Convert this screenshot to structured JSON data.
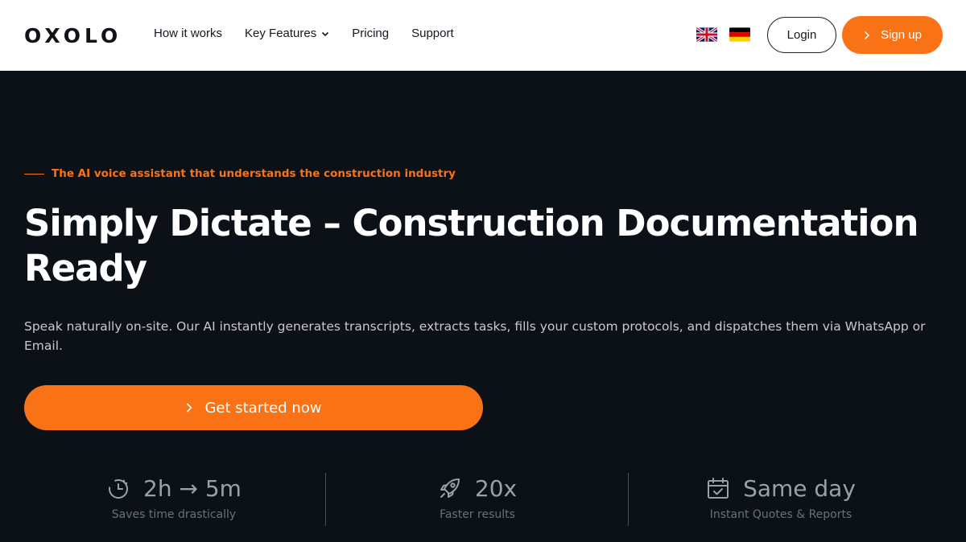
{
  "header": {
    "logo": "OXOLO",
    "nav": [
      {
        "label": "How it works"
      },
      {
        "label": "Key Features",
        "has_dropdown": true
      },
      {
        "label": "Pricing"
      },
      {
        "label": "Support"
      }
    ],
    "languages": [
      "english-flag-icon",
      "german-flag-icon"
    ],
    "login_label": "Login",
    "signup_label": "Sign up"
  },
  "hero": {
    "tagline": "The AI voice assistant that understands the construction industry",
    "title": "Simply Dictate – Construction Documentation Ready",
    "subtitle": "Speak naturally on-site. Our AI instantly generates transcripts, extracts tasks, fills your custom protocols, and dispatches them via WhatsApp or Email.",
    "cta_label": "Get started now"
  },
  "stats": [
    {
      "icon": "stopwatch-icon",
      "value": "2h → 5m",
      "label": "Saves time drastically"
    },
    {
      "icon": "rocket-icon",
      "value": "20x",
      "label": "Faster results"
    },
    {
      "icon": "calendar-check-icon",
      "value": "Same day",
      "label": "Instant Quotes & Reports"
    }
  ],
  "colors": {
    "accent": "#f97316",
    "hero_bg": "#0c1117",
    "header_bg": "#ffffff"
  }
}
